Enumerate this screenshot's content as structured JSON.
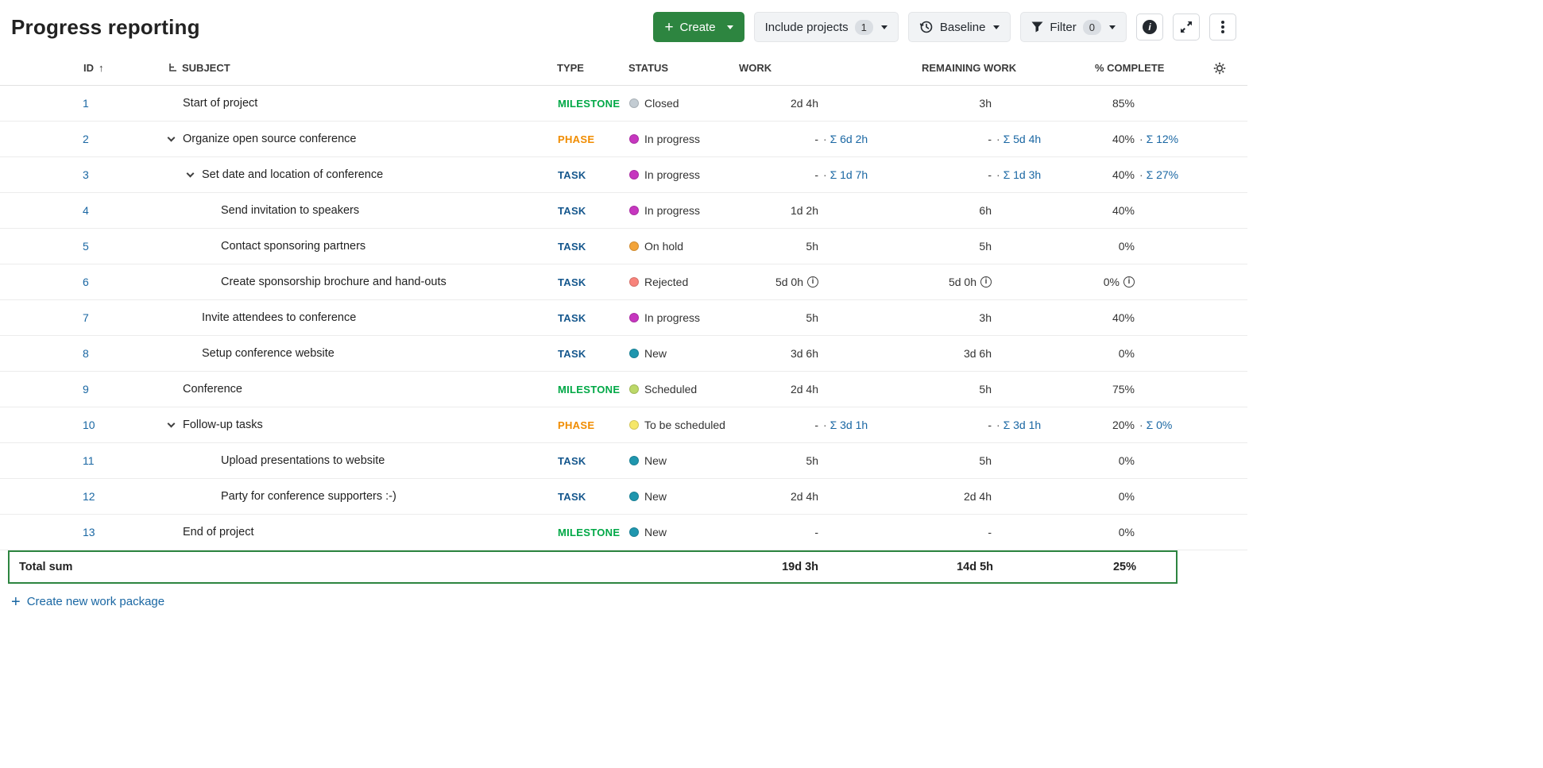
{
  "page": {
    "title": "Progress reporting"
  },
  "toolbar": {
    "create_label": "Create",
    "include_projects_label": "Include projects",
    "include_projects_count": "1",
    "baseline_label": "Baseline",
    "filter_label": "Filter",
    "filter_count": "0"
  },
  "icons": {
    "plus": "+",
    "sort_asc": "↑"
  },
  "table": {
    "columns": {
      "id": "ID",
      "subject": "SUBJECT",
      "type": "TYPE",
      "status": "STATUS",
      "work": "WORK",
      "remaining": "REMAINING WORK",
      "complete": "% COMPLETE"
    },
    "rows": [
      {
        "id": "1",
        "indent": 0,
        "chevron": false,
        "subject": "Start of project",
        "type": "MILESTONE",
        "status": "Closed",
        "work": "2d 4h",
        "remaining": "3h",
        "complete": "85%"
      },
      {
        "id": "2",
        "indent": 0,
        "chevron": true,
        "subject": "Organize open source conference",
        "type": "PHASE",
        "status": "In progress",
        "work": "-",
        "work_sum": "Σ 6d 2h",
        "remaining": "-",
        "remaining_sum": "Σ 5d 4h",
        "complete": "40%",
        "complete_sum": "Σ 12%"
      },
      {
        "id": "3",
        "indent": 1,
        "chevron": true,
        "subject": "Set date and location of conference",
        "type": "TASK",
        "status": "In progress",
        "work": "-",
        "work_sum": "Σ 1d 7h",
        "remaining": "-",
        "remaining_sum": "Σ 1d 3h",
        "complete": "40%",
        "complete_sum": "Σ 27%"
      },
      {
        "id": "4",
        "indent": 2,
        "chevron": false,
        "subject": "Send invitation to speakers",
        "type": "TASK",
        "status": "In progress",
        "work": "1d 2h",
        "remaining": "6h",
        "complete": "40%"
      },
      {
        "id": "5",
        "indent": 2,
        "chevron": false,
        "subject": "Contact sponsoring partners",
        "type": "TASK",
        "status": "On hold",
        "work": "5h",
        "remaining": "5h",
        "complete": "0%"
      },
      {
        "id": "6",
        "indent": 2,
        "chevron": false,
        "subject": "Create sponsorship brochure and hand-outs",
        "type": "TASK",
        "status": "Rejected",
        "work": "5d 0h",
        "work_info": true,
        "remaining": "5d 0h",
        "remaining_info": true,
        "complete": "0%",
        "complete_info": true
      },
      {
        "id": "7",
        "indent": 1,
        "chevron": false,
        "subject": "Invite attendees to conference",
        "type": "TASK",
        "status": "In progress",
        "work": "5h",
        "remaining": "3h",
        "complete": "40%"
      },
      {
        "id": "8",
        "indent": 1,
        "chevron": false,
        "subject": "Setup conference website",
        "type": "TASK",
        "status": "New",
        "work": "3d 6h",
        "remaining": "3d 6h",
        "complete": "0%"
      },
      {
        "id": "9",
        "indent": 0,
        "chevron": false,
        "subject": "Conference",
        "type": "MILESTONE",
        "status": "Scheduled",
        "work": "2d 4h",
        "remaining": "5h",
        "complete": "75%"
      },
      {
        "id": "10",
        "indent": 0,
        "chevron": true,
        "subject": "Follow-up tasks",
        "type": "PHASE",
        "status": "To be scheduled",
        "work": "-",
        "work_sum": "Σ 3d 1h",
        "remaining": "-",
        "remaining_sum": "Σ 3d 1h",
        "complete": "20%",
        "complete_sum": "Σ 0%"
      },
      {
        "id": "11",
        "indent": 2,
        "chevron": false,
        "subject": "Upload presentations to website",
        "type": "TASK",
        "status": "New",
        "work": "5h",
        "remaining": "5h",
        "complete": "0%"
      },
      {
        "id": "12",
        "indent": 2,
        "chevron": false,
        "subject": "Party for conference supporters :-)",
        "type": "TASK",
        "status": "New",
        "work": "2d 4h",
        "remaining": "2d 4h",
        "complete": "0%"
      },
      {
        "id": "13",
        "indent": 0,
        "chevron": false,
        "subject": "End of project",
        "type": "MILESTONE",
        "status": "New",
        "work": "-",
        "remaining": "-",
        "complete": "0%"
      }
    ],
    "sum_row": {
      "label": "Total sum",
      "work": "19d 3h",
      "remaining": "14d 5h",
      "complete": "25%"
    }
  },
  "footer": {
    "create_link": "Create new work package"
  },
  "colors": {
    "link": "#1A67A3",
    "primary_green": "#2D8540",
    "sum_border": "#2D8540",
    "type": {
      "MILESTONE": "#00A846",
      "PHASE": "#F08C00",
      "TASK": "#15578D"
    },
    "status": {
      "Closed": "#C3CCD3",
      "In progress": "#C636BF",
      "On hold": "#F3A43A",
      "Rejected": "#F8837B",
      "New": "#1F96AE",
      "Scheduled": "#BCD868",
      "To be scheduled": "#F6E768"
    }
  }
}
